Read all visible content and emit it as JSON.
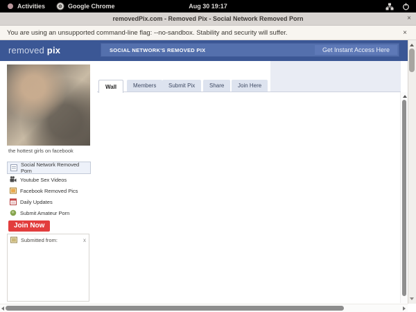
{
  "topbar": {
    "activities_label": "Activities",
    "app_label": "Google Chrome",
    "clock": "Aug 30 19:17"
  },
  "browser": {
    "tab_title": "removedPix.com - Removed Pix - Social Network Removed Porn",
    "tab_close": "×",
    "infobar_message": "You are using an unsupported command-line flag: --no-sandbox. Stability and security will suffer.",
    "infobar_close": "×"
  },
  "site": {
    "logo": {
      "light": "removed",
      "bold": "pix"
    },
    "banner_text": "SOCIAL NETWORK'S REMOVED PIX",
    "cta_label": "Get Instant Access Here",
    "tabs": [
      {
        "label": "Wall",
        "active": true
      },
      {
        "label": "Members",
        "active": false
      },
      {
        "label": "Submit Pix",
        "active": false
      },
      {
        "label": "Share",
        "active": false
      },
      {
        "label": "Join Here",
        "active": false
      }
    ],
    "sidebar": {
      "photo_caption": "the hottest girls on facebook",
      "menu": [
        {
          "label": "Social Network Removed Porn",
          "icon": "note-icon",
          "active": true
        },
        {
          "label": "Youtube Sex Videos",
          "icon": "video-camera-icon",
          "active": false
        },
        {
          "label": "Facebook Removed Pics",
          "icon": "photo-icon",
          "active": false
        },
        {
          "label": "Daily Updates",
          "icon": "calendar-icon",
          "active": false
        },
        {
          "label": "Submit Amateur Porn",
          "icon": "camera-icon",
          "active": false
        }
      ],
      "join_button_label": "Join Now",
      "submitted_from": {
        "label": "Submitted from:",
        "icon": "photo-icon",
        "close": "x"
      }
    },
    "colors": {
      "header_blue": "#3b5795",
      "banner_blue": "#5470ad",
      "tab_inactive": "#dde3ef",
      "join_red": "#e23d3d"
    }
  }
}
